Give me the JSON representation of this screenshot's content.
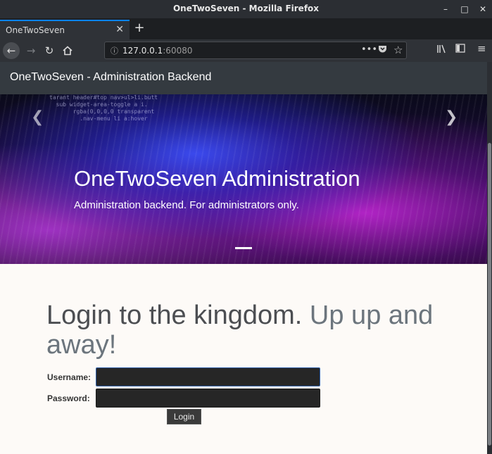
{
  "window": {
    "title": "OneTwoSeven - Mozilla Firefox"
  },
  "tabs": [
    {
      "label": "OneTwoSeven",
      "active": true
    }
  ],
  "urlbar": {
    "host": "127.0.0.1",
    "port": ":60080"
  },
  "site": {
    "brand": "OneTwoSeven - Administration Backend"
  },
  "hero": {
    "title": "OneTwoSeven Administration",
    "subtitle": "Administration backend. For administrators only.",
    "code_lines": [
      "tаrant header#top nav>ul>li.butt",
      "  sub widget-area-toggle a i.",
      "       rgba(0,0,0,0 transparent",
      "         .nav-menu li a:hover"
    ]
  },
  "login": {
    "heading_main": "Login to the kingdom.",
    "heading_muted": "Up up and away!",
    "username_label": "Username:",
    "password_label": "Password:",
    "username_value": "",
    "password_value": "",
    "button_label": "Login"
  },
  "colors": {
    "navbar_bg": "#343a40",
    "page_bg": "#fdfaf7",
    "heading": "#4c4e52",
    "heading_muted": "#6c757d",
    "input_bg": "#262626",
    "tab_accent": "#0a84ff"
  },
  "icons": {
    "minimize": "minimize-icon",
    "maximize": "maximize-icon",
    "close": "close-icon",
    "back": "back-arrow-icon",
    "forward": "forward-arrow-icon",
    "reload": "reload-icon",
    "home": "home-icon",
    "info": "info-icon",
    "more": "more-actions-icon",
    "pocket": "pocket-icon",
    "bookmark": "bookmark-star-icon",
    "library": "library-icon",
    "sidebar": "sidebar-icon",
    "menu": "hamburger-menu-icon"
  }
}
